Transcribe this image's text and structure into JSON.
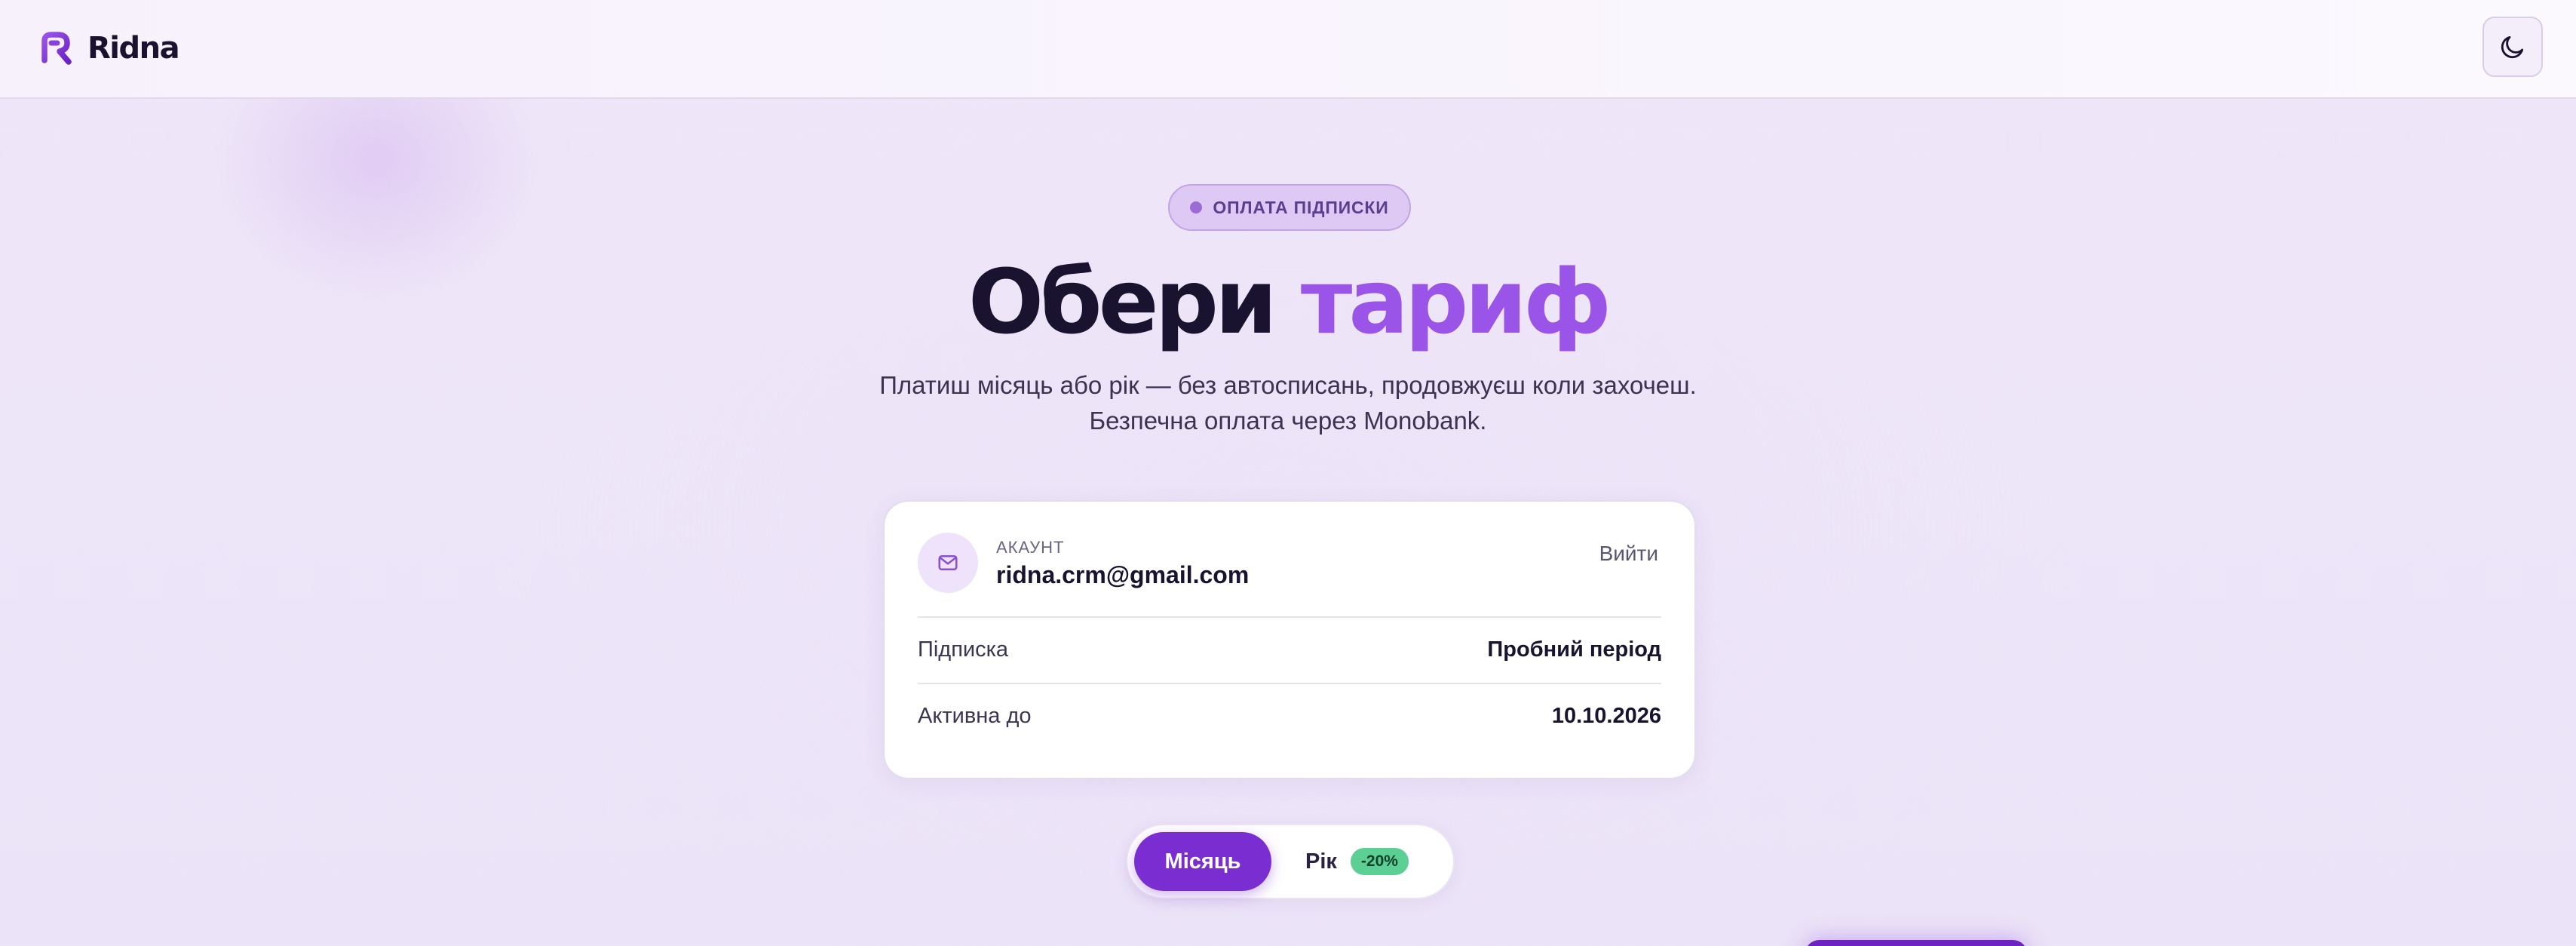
{
  "header": {
    "brand": "Ridna",
    "logo_icon": "ridna-logo-icon",
    "theme_toggle_icon": "moon-icon"
  },
  "hero": {
    "badge": "ОПЛАТА ПІДПИСКИ",
    "title_main": "Обери",
    "title_accent": "тариф",
    "subtitle_line1": "Платиш місяць або рік — без автосписань, продовжуєш коли захочеш.",
    "subtitle_line2": "Безпечна оплата через Monobank."
  },
  "account": {
    "icon": "mail-icon",
    "label": "АКАУНТ",
    "email": "ridna.crm@gmail.com",
    "logout_label": "Вийти",
    "rows": [
      {
        "label": "Підписка",
        "value": "Пробний період"
      },
      {
        "label": "Активна до",
        "value": "10.10.2026"
      }
    ]
  },
  "billing_toggle": {
    "month_label": "Місяць",
    "year_label": "Рік",
    "year_discount": "-20%",
    "selected": "month"
  },
  "colors": {
    "accent": "#9b54e8",
    "primary_button": "#7a2ed2",
    "discount_badge": "#5ccf95",
    "text_dark": "#1a1330"
  }
}
